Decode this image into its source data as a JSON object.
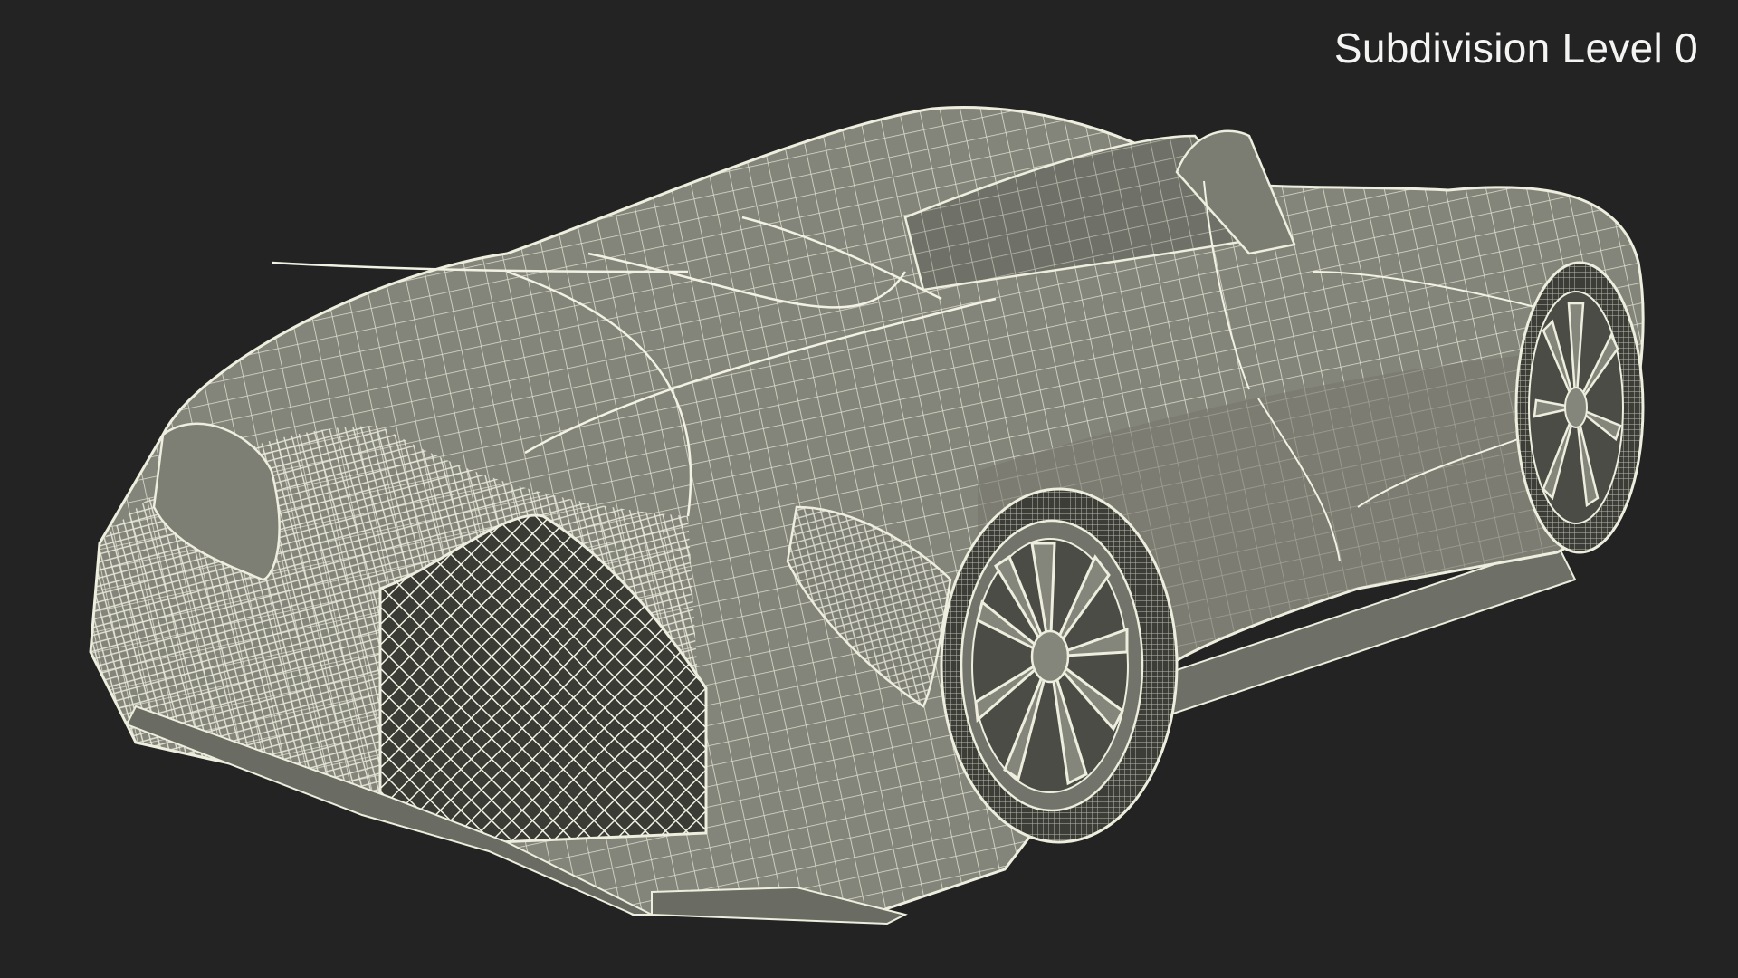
{
  "overlay": {
    "label": "Subdivision Level 0"
  },
  "colors": {
    "background": "#232323",
    "surface": "#84857a",
    "wire": "#eeeedf",
    "shadow": "#4a4b44",
    "label": "#f4f4f2"
  }
}
